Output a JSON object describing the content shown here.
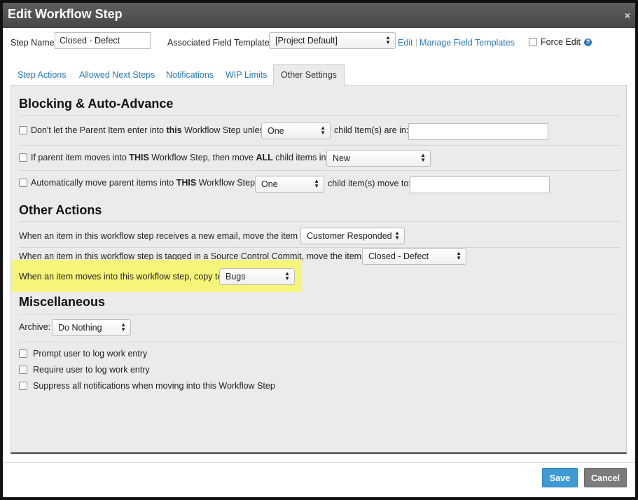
{
  "dialog": {
    "title": "Edit Workflow Step",
    "close": "×"
  },
  "header": {
    "step_name_label": "Step Name",
    "step_name_value": "Closed - Defect",
    "field_template_label": "Associated Field Template",
    "field_template_value": "[Project Default]",
    "edit_link": "Edit",
    "separator": "|",
    "manage_link": "Manage Field Templates",
    "force_edit_label": "Force Edit",
    "help": "?"
  },
  "tabs": [
    {
      "label": "Step Actions"
    },
    {
      "label": "Allowed Next Steps"
    },
    {
      "label": "Notifications"
    },
    {
      "label": "WIP Limits"
    },
    {
      "label": "Other Settings"
    }
  ],
  "blocking": {
    "heading": "Blocking & Auto-Advance",
    "row1": {
      "pre": "Don't let the Parent Item enter into ",
      "bold": "this",
      "post": " Workflow Step unless",
      "select": "One",
      "after": "child Item(s) are in:",
      "input": ""
    },
    "row2": {
      "pre": "If parent item moves into ",
      "bold1": "THIS",
      "mid": " Workflow Step, then move ",
      "bold2": "ALL",
      "post": " child items into:",
      "select": "New"
    },
    "row3": {
      "pre": "Automatically move parent items into ",
      "bold": "THIS",
      "post": " Workflow Step if",
      "select": "One",
      "after": "child item(s) move to:",
      "input": ""
    }
  },
  "other": {
    "heading": "Other Actions",
    "email_label": "When an item in this workflow step receives a new email, move the item to:",
    "email_select": "Customer Responded",
    "commit_label": "When an item in this workflow step is tagged in a Source Control Commit, move the item to:",
    "commit_select": "Closed - Defect",
    "copy_label": "When an item moves into this workflow step, copy to:",
    "copy_select": "Bugs"
  },
  "misc": {
    "heading": "Miscellaneous",
    "archive_label": "Archive:",
    "archive_select": "Do Nothing",
    "prompt_label": "Prompt user to log work entry",
    "require_label": "Require user to log work entry",
    "suppress_label": "Suppress all notifications when moving into this Workflow Step"
  },
  "footer": {
    "save": "Save",
    "cancel": "Cancel"
  },
  "colors": {
    "accent": "#2a7ab7",
    "save": "#3e9bd5",
    "cancel": "#7c7c7c",
    "highlight": "#f5f57a"
  }
}
